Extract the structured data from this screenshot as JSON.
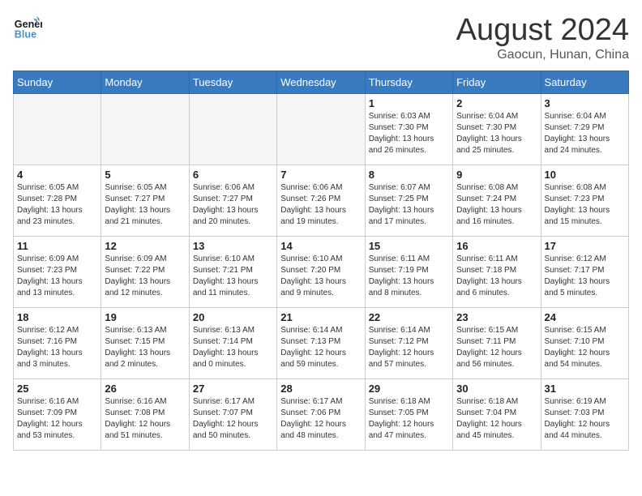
{
  "header": {
    "logo_text_general": "General",
    "logo_text_blue": "Blue",
    "month_title": "August 2024",
    "location": "Gaocun, Hunan, China"
  },
  "days_of_week": [
    "Sunday",
    "Monday",
    "Tuesday",
    "Wednesday",
    "Thursday",
    "Friday",
    "Saturday"
  ],
  "weeks": [
    [
      {
        "day": "",
        "info": ""
      },
      {
        "day": "",
        "info": ""
      },
      {
        "day": "",
        "info": ""
      },
      {
        "day": "",
        "info": ""
      },
      {
        "day": "1",
        "info": "Sunrise: 6:03 AM\nSunset: 7:30 PM\nDaylight: 13 hours\nand 26 minutes."
      },
      {
        "day": "2",
        "info": "Sunrise: 6:04 AM\nSunset: 7:30 PM\nDaylight: 13 hours\nand 25 minutes."
      },
      {
        "day": "3",
        "info": "Sunrise: 6:04 AM\nSunset: 7:29 PM\nDaylight: 13 hours\nand 24 minutes."
      }
    ],
    [
      {
        "day": "4",
        "info": "Sunrise: 6:05 AM\nSunset: 7:28 PM\nDaylight: 13 hours\nand 23 minutes."
      },
      {
        "day": "5",
        "info": "Sunrise: 6:05 AM\nSunset: 7:27 PM\nDaylight: 13 hours\nand 21 minutes."
      },
      {
        "day": "6",
        "info": "Sunrise: 6:06 AM\nSunset: 7:27 PM\nDaylight: 13 hours\nand 20 minutes."
      },
      {
        "day": "7",
        "info": "Sunrise: 6:06 AM\nSunset: 7:26 PM\nDaylight: 13 hours\nand 19 minutes."
      },
      {
        "day": "8",
        "info": "Sunrise: 6:07 AM\nSunset: 7:25 PM\nDaylight: 13 hours\nand 17 minutes."
      },
      {
        "day": "9",
        "info": "Sunrise: 6:08 AM\nSunset: 7:24 PM\nDaylight: 13 hours\nand 16 minutes."
      },
      {
        "day": "10",
        "info": "Sunrise: 6:08 AM\nSunset: 7:23 PM\nDaylight: 13 hours\nand 15 minutes."
      }
    ],
    [
      {
        "day": "11",
        "info": "Sunrise: 6:09 AM\nSunset: 7:23 PM\nDaylight: 13 hours\nand 13 minutes."
      },
      {
        "day": "12",
        "info": "Sunrise: 6:09 AM\nSunset: 7:22 PM\nDaylight: 13 hours\nand 12 minutes."
      },
      {
        "day": "13",
        "info": "Sunrise: 6:10 AM\nSunset: 7:21 PM\nDaylight: 13 hours\nand 11 minutes."
      },
      {
        "day": "14",
        "info": "Sunrise: 6:10 AM\nSunset: 7:20 PM\nDaylight: 13 hours\nand 9 minutes."
      },
      {
        "day": "15",
        "info": "Sunrise: 6:11 AM\nSunset: 7:19 PM\nDaylight: 13 hours\nand 8 minutes."
      },
      {
        "day": "16",
        "info": "Sunrise: 6:11 AM\nSunset: 7:18 PM\nDaylight: 13 hours\nand 6 minutes."
      },
      {
        "day": "17",
        "info": "Sunrise: 6:12 AM\nSunset: 7:17 PM\nDaylight: 13 hours\nand 5 minutes."
      }
    ],
    [
      {
        "day": "18",
        "info": "Sunrise: 6:12 AM\nSunset: 7:16 PM\nDaylight: 13 hours\nand 3 minutes."
      },
      {
        "day": "19",
        "info": "Sunrise: 6:13 AM\nSunset: 7:15 PM\nDaylight: 13 hours\nand 2 minutes."
      },
      {
        "day": "20",
        "info": "Sunrise: 6:13 AM\nSunset: 7:14 PM\nDaylight: 13 hours\nand 0 minutes."
      },
      {
        "day": "21",
        "info": "Sunrise: 6:14 AM\nSunset: 7:13 PM\nDaylight: 12 hours\nand 59 minutes."
      },
      {
        "day": "22",
        "info": "Sunrise: 6:14 AM\nSunset: 7:12 PM\nDaylight: 12 hours\nand 57 minutes."
      },
      {
        "day": "23",
        "info": "Sunrise: 6:15 AM\nSunset: 7:11 PM\nDaylight: 12 hours\nand 56 minutes."
      },
      {
        "day": "24",
        "info": "Sunrise: 6:15 AM\nSunset: 7:10 PM\nDaylight: 12 hours\nand 54 minutes."
      }
    ],
    [
      {
        "day": "25",
        "info": "Sunrise: 6:16 AM\nSunset: 7:09 PM\nDaylight: 12 hours\nand 53 minutes."
      },
      {
        "day": "26",
        "info": "Sunrise: 6:16 AM\nSunset: 7:08 PM\nDaylight: 12 hours\nand 51 minutes."
      },
      {
        "day": "27",
        "info": "Sunrise: 6:17 AM\nSunset: 7:07 PM\nDaylight: 12 hours\nand 50 minutes."
      },
      {
        "day": "28",
        "info": "Sunrise: 6:17 AM\nSunset: 7:06 PM\nDaylight: 12 hours\nand 48 minutes."
      },
      {
        "day": "29",
        "info": "Sunrise: 6:18 AM\nSunset: 7:05 PM\nDaylight: 12 hours\nand 47 minutes."
      },
      {
        "day": "30",
        "info": "Sunrise: 6:18 AM\nSunset: 7:04 PM\nDaylight: 12 hours\nand 45 minutes."
      },
      {
        "day": "31",
        "info": "Sunrise: 6:19 AM\nSunset: 7:03 PM\nDaylight: 12 hours\nand 44 minutes."
      }
    ]
  ]
}
